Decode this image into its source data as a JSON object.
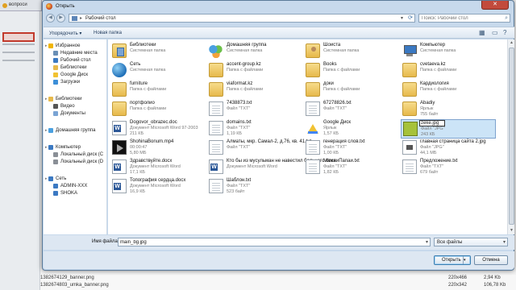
{
  "background": {
    "tab_label": "вопроси",
    "files": [
      {
        "name": "1382674129_banner.png",
        "dims": "220x466",
        "size": "2,94 Kb"
      },
      {
        "name": "1382674803_umka_banner.png",
        "dims": "220x342",
        "size": "106,78 Kb"
      }
    ]
  },
  "dialog": {
    "title": "Открыть",
    "close_icon": "close-icon",
    "address": {
      "breadcrumb": "Рабочий стол",
      "search_placeholder": "Поиск: Рабочий стол"
    },
    "toolbar": {
      "organize": "Упорядочить ▾",
      "new_folder": "Новая папка"
    },
    "nav": [
      {
        "label": "Избранное",
        "indent": 0,
        "icon": "star-icon",
        "color": "#f0b400",
        "caret": true
      },
      {
        "label": "Недавние места",
        "indent": 1,
        "icon": "recent-places-icon",
        "color": "#6a8fb5"
      },
      {
        "label": "Рабочий стол",
        "indent": 1,
        "icon": "desktop-icon",
        "color": "#3b79c2"
      },
      {
        "label": "Библиотеки",
        "indent": 1,
        "icon": "libraries-icon",
        "color": "#e7b94b"
      },
      {
        "label": "Google Диск",
        "indent": 1,
        "icon": "google-drive-icon",
        "color": "#f1c232"
      },
      {
        "label": "Загрузки",
        "indent": 1,
        "icon": "downloads-icon",
        "color": "#3c8fd8"
      },
      {
        "label": "Библиотеки",
        "indent": 0,
        "icon": "library-icon",
        "color": "#e7b94b",
        "caret": true
      },
      {
        "label": "Видео",
        "indent": 1,
        "icon": "video-icon",
        "color": "#555555"
      },
      {
        "label": "Документы",
        "indent": 1,
        "icon": "documents-icon",
        "color": "#7aa4d4"
      },
      {
        "label": "Домашняя группа",
        "indent": 0,
        "icon": "homegroup-icon",
        "color": "#4aa0e0",
        "caret": true
      },
      {
        "label": "Компьютер",
        "indent": 0,
        "icon": "computer-icon",
        "color": "#3b79c2",
        "caret": true
      },
      {
        "label": "Локальный диск (C",
        "indent": 1,
        "icon": "drive-icon",
        "color": "#8a8f96"
      },
      {
        "label": "Локальный диск (D",
        "indent": 1,
        "icon": "drive-icon",
        "color": "#8a8f96"
      },
      {
        "label": "Сеть",
        "indent": 0,
        "icon": "network-icon",
        "color": "#3b79c2",
        "caret": true
      },
      {
        "label": "ADMIN-XXX",
        "indent": 1,
        "icon": "pc-icon",
        "color": "#3b79c2"
      },
      {
        "label": "SHOKA",
        "indent": 1,
        "icon": "pc-icon",
        "color": "#3b79c2"
      }
    ],
    "items": [
      [
        {
          "name": "Библиотеки",
          "l2": "Системная папка",
          "l3": "",
          "icon": "lib"
        },
        {
          "name": "Домашняя группа",
          "l2": "Системная папка",
          "l3": "",
          "icon": "home"
        },
        {
          "name": "Шоиста",
          "l2": "Системная папка",
          "l3": "",
          "icon": "person"
        },
        {
          "name": "Компьютер",
          "l2": "Системная папка",
          "l3": "",
          "icon": "computer"
        }
      ],
      [
        {
          "name": "Сеть",
          "l2": "Системная папка",
          "l3": "",
          "icon": "globe"
        },
        {
          "name": "accent-group.kz",
          "l2": "Папка с файлами",
          "l3": "",
          "icon": "folder"
        },
        {
          "name": "Books",
          "l2": "Папка с файлами",
          "l3": "",
          "icon": "folder"
        },
        {
          "name": "cvetaeva.kz",
          "l2": "Папка с файлами",
          "l3": "",
          "icon": "folder"
        }
      ],
      [
        {
          "name": "furniture",
          "l2": "Папка с файлами",
          "l3": "",
          "icon": "folder"
        },
        {
          "name": "viaformat.kz",
          "l2": "Папка с файлами",
          "l3": "",
          "icon": "folder"
        },
        {
          "name": "доки",
          "l2": "Папка с файлами",
          "l3": "",
          "icon": "folder"
        },
        {
          "name": "Кардиология",
          "l2": "Папка с файлами",
          "l3": "",
          "icon": "folder"
        }
      ],
      [
        {
          "name": "портфолио",
          "l2": "Папка с файлами",
          "l3": "",
          "icon": "folder"
        },
        {
          "name": "7438873.txt",
          "l2": "Файл \"TXT\"",
          "l3": "",
          "icon": "doc"
        },
        {
          "name": "67278826.txt",
          "l2": "Файл \"TXT\"",
          "l3": "",
          "icon": "doc"
        },
        {
          "name": "Abadiy",
          "l2": "Ярлык",
          "l3": "755 байт",
          "icon": "folder"
        }
      ],
      [
        {
          "name": "Dogovor_obrazec.doc",
          "l2": "Документ Microsoft Word 97-2003",
          "l3": "211 КБ",
          "icon": "word"
        },
        {
          "name": "domains.txt",
          "l2": "Файл \"TXT\"",
          "l3": "1,19 КБ",
          "icon": "doc"
        },
        {
          "name": "Google Диск",
          "l2": "Ярлык",
          "l3": "1,57 КБ",
          "icon": "gdrive"
        },
        {
          "name": "zeke.jpg",
          "l2": "Файл \"JPG\"",
          "l3": "243 КБ",
          "icon": "image-g",
          "selected": true,
          "renaming": true
        }
      ],
      [
        {
          "name": "ShohinaBonum.mp4",
          "l2": "00:00:47",
          "l3": "5,80 МБ",
          "icon": "video"
        },
        {
          "name": "Алматы, мкр. Самал-2, д.76, кв. 41.txt",
          "l2": "Файл \"TXT\"",
          "l3": "",
          "icon": "doc"
        },
        {
          "name": "генерация слов.txt",
          "l2": "Файл \"TXT\"",
          "l3": "1,00 КБ",
          "icon": "doc"
        },
        {
          "name": "главная страница сайта 2.jpg",
          "l2": "Файл \"JPG\"",
          "l3": "44,1 МБ",
          "icon": "image-w"
        }
      ],
      [
        {
          "name": "Здравствуйте.docx",
          "l2": "Документ Microsoft Word",
          "l3": "17,1 КБ",
          "icon": "word"
        },
        {
          "name": "Кто бы из мусульман не навестил больного.docx",
          "l2": "Документ Microsoft Word",
          "l3": "",
          "icon": "word"
        },
        {
          "name": "МамаиПапаи.txt",
          "l2": "Файл \"TXT\"",
          "l3": "1,82 КБ",
          "icon": "doc"
        },
        {
          "name": "Предложение.txt",
          "l2": "Файл \"TXT\"",
          "l3": "679 байт",
          "icon": "doc"
        }
      ],
      [
        {
          "name": "Топография сердца.docx",
          "l2": "Документ Microsoft Word",
          "l3": "16,9 КБ",
          "icon": "word"
        },
        {
          "name": "Шаблон.txt",
          "l2": "Файл \"TXT\"",
          "l3": "523 байт",
          "icon": "doc"
        }
      ]
    ],
    "filename": {
      "label": "Имя файла:",
      "value": "main_bg.jpg"
    },
    "filetype": {
      "selected": "Все файлы"
    },
    "buttons": {
      "open": "Открыть",
      "cancel": "Отмена"
    },
    "accent": "#cce4f7"
  }
}
